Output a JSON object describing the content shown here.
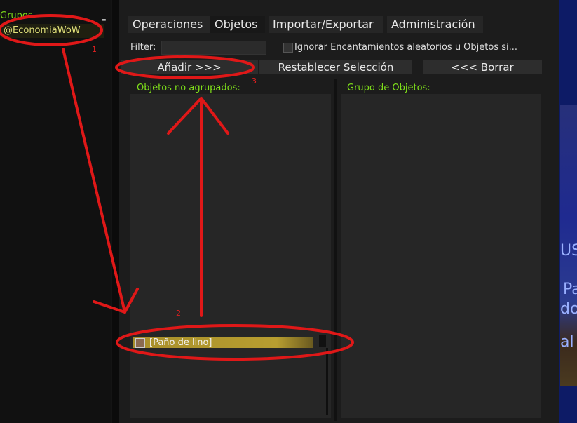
{
  "sidebar": {
    "title": "Grupos",
    "collapse_symbol": "-",
    "groups": [
      "@EconomiaWoW"
    ]
  },
  "tabs": [
    "Operaciones",
    "Objetos",
    "Importar/Exportar",
    "Administración"
  ],
  "filter": {
    "label": "Filter:",
    "value": ""
  },
  "ignore_checkbox": {
    "label": "Ignorar Encantamientos aleatorios u Objetos si...",
    "checked": false
  },
  "buttons": {
    "add": "Añadir >>>",
    "reset": "Restablecer Selección",
    "remove": "<<< Borrar"
  },
  "panels": {
    "ungrouped": {
      "title": "Objetos no agrupados:",
      "items": [
        "[Paño de lino]"
      ]
    },
    "grouped": {
      "title": "Grupo de Objetos:",
      "items": []
    }
  },
  "annotations": {
    "n1": "1",
    "n2": "2",
    "n3": "3",
    "color": "#e01818"
  },
  "background_text": {
    "t1": "US",
    "t2": "Pa",
    "t3": "dow",
    "t4": "al"
  }
}
